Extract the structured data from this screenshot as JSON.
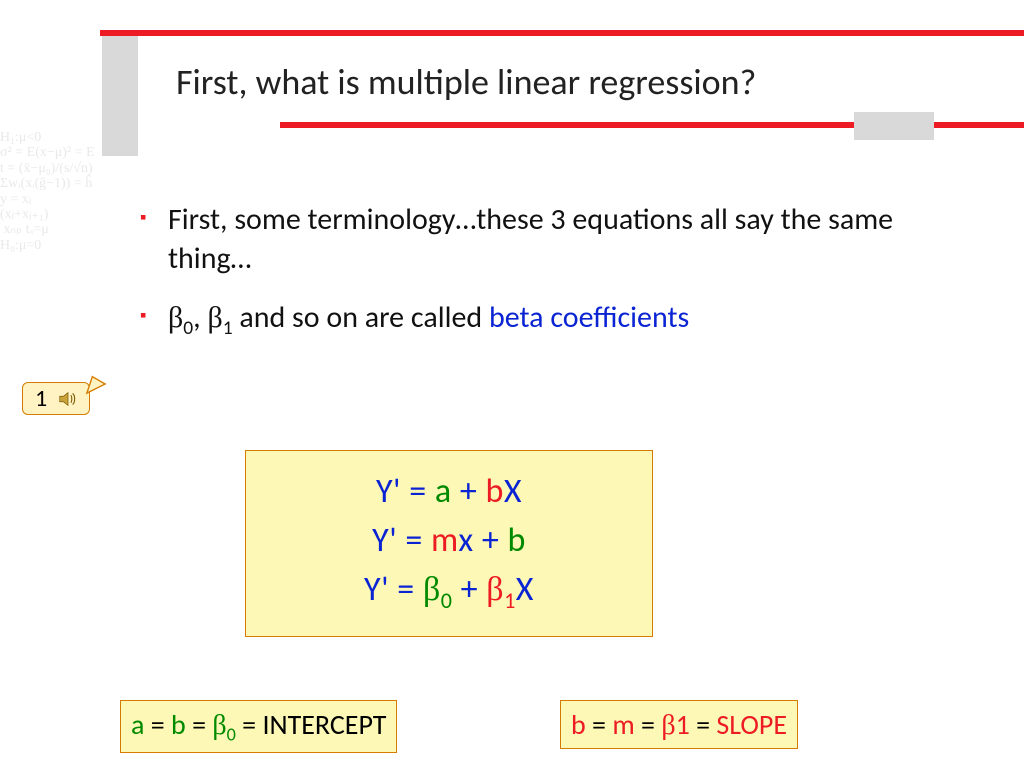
{
  "title": "First, what is multiple linear regression?",
  "bullets": {
    "b1": "First, some terminology…these 3 equations all say the same thing…",
    "b2_prefix_beta0": "β",
    "b2_sub0": "0",
    "b2_sep": ", ",
    "b2_prefix_beta1": "β",
    "b2_sub1": "1",
    "b2_mid": " and so on are called ",
    "b2_blue": "beta coefficients"
  },
  "callout": {
    "label": "1"
  },
  "equations": {
    "row1": {
      "y": "Y' = ",
      "a": "a",
      "plus": " + ",
      "b": "b",
      "x": "X"
    },
    "row2": {
      "y": "Y' = ",
      "m": "m",
      "x": "x",
      "plus": " + ",
      "b": "b"
    },
    "row3": {
      "y": "Y' = ",
      "b0": "β",
      "s0": "0",
      "plus": " + ",
      "b1": "β",
      "s1": "1",
      "x": "X"
    }
  },
  "bottom": {
    "left": {
      "a": "a",
      "eq1": " = ",
      "b": "b",
      "eq2": " = ",
      "beta": "β",
      "s0": "0",
      "eq3": " = ",
      "label": "INTERCEPT"
    },
    "right": {
      "b": "b",
      "eq1": " = ",
      "m": "m",
      "eq2": " = ",
      "beta": "β",
      "s1": "1",
      "eq3": " = ",
      "label": "SLOPE"
    }
  },
  "bg_math": "H₁:μ<0\nσ² = E(x−μ)² = E\nt = (x̄−μ₀)/(s/√n)\nΣwᵢ(xᵢ(ĝ−1)) = ĥ\ny = xⱼ\n(xⱼ+xⱼ₊₁)\n xₙₚ tₓ=μ\nH₀:μ=0"
}
